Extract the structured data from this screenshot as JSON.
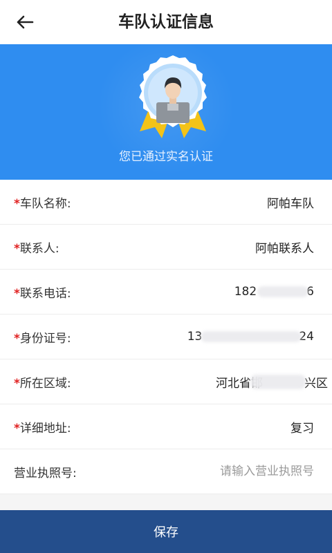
{
  "header": {
    "title": "车队认证信息"
  },
  "hero": {
    "verified_text": "您已通过实名认证"
  },
  "form": {
    "required_mark": "*",
    "fields": [
      {
        "label": "车队名称:",
        "value": "阿帕车队",
        "required": true
      },
      {
        "label": "联系人:",
        "value": "阿帕联系人",
        "required": true
      },
      {
        "label": "联系电话:",
        "value": "182",
        "value_tail": "6",
        "required": true
      },
      {
        "label": "身份证号:",
        "value": "13",
        "value_tail": "24",
        "required": true
      },
      {
        "label": "所在区域:",
        "value": "河北省邯",
        "value_tail": "兴区",
        "required": true
      },
      {
        "label": "详细地址:",
        "value": "复习",
        "required": true
      },
      {
        "label": "营业执照号:",
        "value": "",
        "placeholder": "请输入营业执照号",
        "required": false
      }
    ]
  },
  "footer": {
    "save_label": "保存"
  },
  "colors": {
    "hero_blue": "#2f8df0",
    "save_button": "#244e8c",
    "required_red": "#e02020"
  },
  "icons": {
    "back": "arrow-left-icon",
    "badge": "verified-badge-icon",
    "avatar": "user-avatar-icon"
  }
}
